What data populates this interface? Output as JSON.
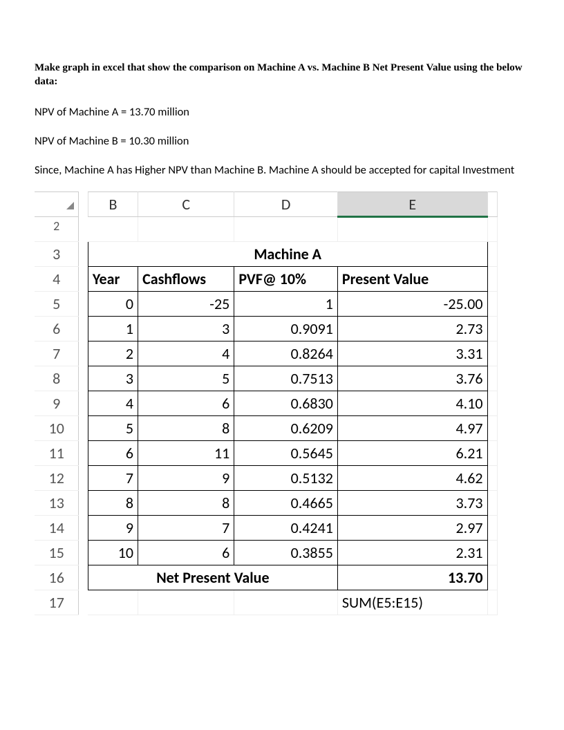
{
  "instruction": "Make graph in excel that show the comparison on Machine A vs. Machine B Net Present Value using the below data:",
  "npv_a_line": "NPV of Machine A = 13.70 million",
  "npv_b_line": "NPV of Machine B = 10.30 million",
  "conclusion": "Since, Machine A has Higher NPV than Machine B. Machine A should be accepted for capital Investment",
  "columns": {
    "B": "B",
    "C": "C",
    "D": "D",
    "E": "E"
  },
  "row_numbers": [
    "2",
    "3",
    "4",
    "5",
    "6",
    "7",
    "8",
    "9",
    "10",
    "11",
    "12",
    "13",
    "14",
    "15",
    "16",
    "17"
  ],
  "table_title": "Machine A",
  "headers": {
    "year": "Year",
    "cash": "Cashflows",
    "pvf": "PVF@ 10%",
    "pv": "Present Value"
  },
  "rows": [
    {
      "year": "0",
      "cash": "-25",
      "pvf": "1",
      "pv": "-25.00"
    },
    {
      "year": "1",
      "cash": "3",
      "pvf": "0.9091",
      "pv": "2.73"
    },
    {
      "year": "2",
      "cash": "4",
      "pvf": "0.8264",
      "pv": "3.31"
    },
    {
      "year": "3",
      "cash": "5",
      "pvf": "0.7513",
      "pv": "3.76"
    },
    {
      "year": "4",
      "cash": "6",
      "pvf": "0.6830",
      "pv": "4.10"
    },
    {
      "year": "5",
      "cash": "8",
      "pvf": "0.6209",
      "pv": "4.97"
    },
    {
      "year": "6",
      "cash": "11",
      "pvf": "0.5645",
      "pv": "6.21"
    },
    {
      "year": "7",
      "cash": "9",
      "pvf": "0.5132",
      "pv": "4.62"
    },
    {
      "year": "8",
      "cash": "8",
      "pvf": "0.4665",
      "pv": "3.73"
    },
    {
      "year": "9",
      "cash": "7",
      "pvf": "0.4241",
      "pv": "2.97"
    },
    {
      "year": "10",
      "cash": "6",
      "pvf": "0.3855",
      "pv": "2.31"
    }
  ],
  "npv_label": "Net Present Value",
  "npv_value": "13.70",
  "formula": "SUM(E5:E15)"
}
